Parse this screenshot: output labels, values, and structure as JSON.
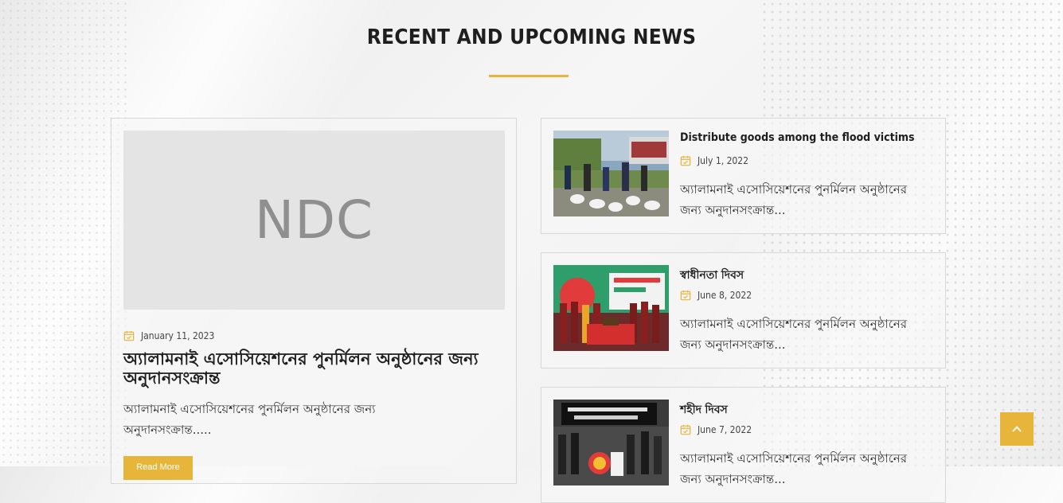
{
  "section": {
    "title": "RECENT AND UPCOMING NEWS",
    "accent_color": "#e6b53a"
  },
  "featured": {
    "image_text": "NDC",
    "date": "January 11, 2023",
    "heading": "অ্যালামনাই এসোসিয়েশনের পুনর্মিলন অনুষ্ঠানের জন্য অনুদানসংক্রান্ত",
    "excerpt": "অ্যালামনাই এসোসিয়েশনের পুনর্মিলন অনুষ্ঠানের জন্য অনুদানসংক্রান্ত.....",
    "read_more_label": "Read More"
  },
  "news_items": [
    {
      "title": "Distribute goods among the flood victims",
      "date": "July 1, 2022",
      "excerpt": "অ্যালামনাই এসোসিয়েশনের পুনর্মিলন অনুষ্ঠানের জন্য অনুদানসংক্রান্ত..."
    },
    {
      "title": "স্বাধীনতা দিবস",
      "date": "June 8, 2022",
      "excerpt": "অ্যালামনাই এসোসিয়েশনের পুনর্মিলন অনুষ্ঠানের জন্য অনুদানসংক্রান্ত..."
    },
    {
      "title": "শহীদ দিবস",
      "date": "June 7, 2022",
      "excerpt": "অ্যালামনাই এসোসিয়েশনের পুনর্মিলন অনুষ্ঠানের জন্য অনুদানসংক্রান্ত..."
    }
  ],
  "icons": {
    "date": "calendar-check-icon",
    "scroll_top": "chevron-up-icon"
  }
}
